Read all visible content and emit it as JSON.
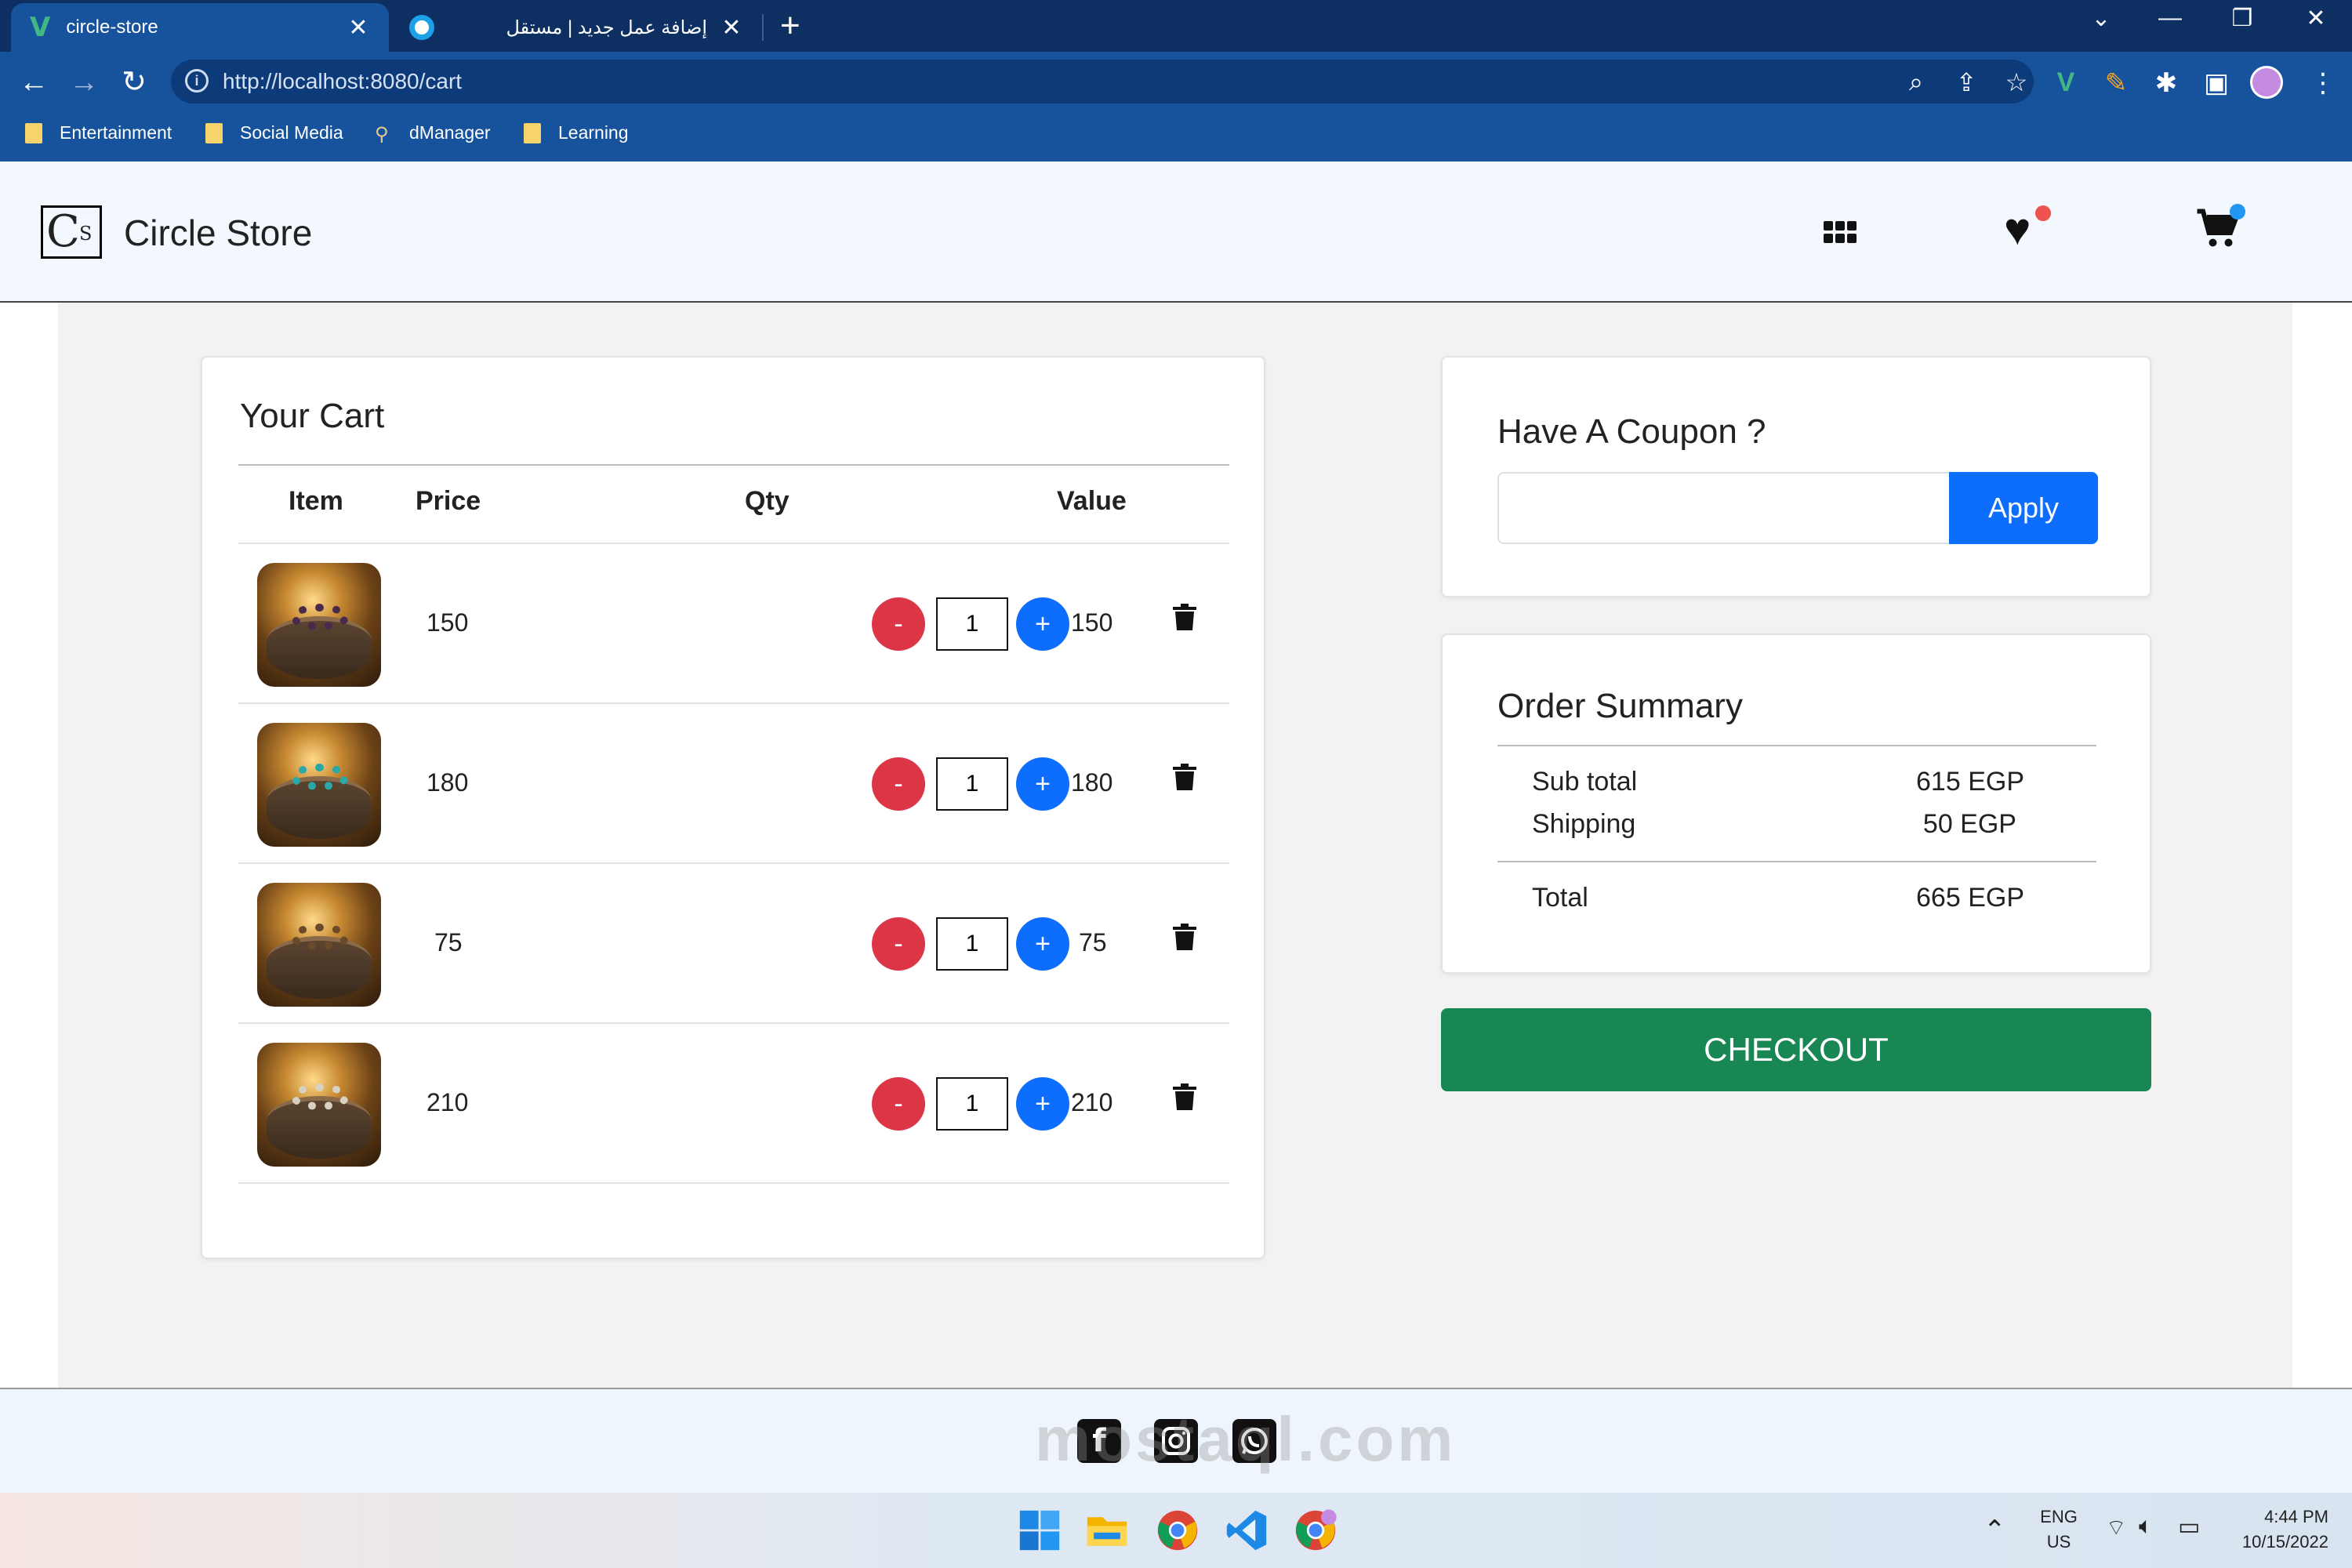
{
  "browser": {
    "tabs": [
      {
        "title": "circle-store",
        "active": true
      },
      {
        "title": "إضافة عمل جديد | مستقل",
        "active": false
      }
    ],
    "url": "http://localhost:8080/cart",
    "bookmarks": [
      "Entertainment",
      "Social Media",
      "dManager",
      "Learning"
    ]
  },
  "site": {
    "logo_letter": "C",
    "logo_sup": "S",
    "brand": "Circle Store"
  },
  "cart": {
    "title": "Your Cart",
    "headers": {
      "item": "Item",
      "price": "Price",
      "qty": "Qty",
      "value": "Value"
    },
    "items": [
      {
        "price": "150",
        "qty": "1",
        "value": "150"
      },
      {
        "price": "180",
        "qty": "1",
        "value": "180"
      },
      {
        "price": "75",
        "qty": "1",
        "value": "75"
      },
      {
        "price": "210",
        "qty": "1",
        "value": "210"
      }
    ],
    "minus_label": "-",
    "plus_label": "+"
  },
  "coupon": {
    "title": "Have A Coupon ?",
    "input_value": "",
    "apply_label": "Apply"
  },
  "summary": {
    "title": "Order Summary",
    "subtotal_label": "Sub total",
    "subtotal_value": "615 EGP",
    "shipping_label": "Shipping",
    "shipping_value": "50 EGP",
    "total_label": "Total",
    "total_value": "665 EGP"
  },
  "checkout_label": "CHECKOUT",
  "watermark": "mostaql.com",
  "taskbar": {
    "lang_top": "ENG",
    "lang_bottom": "US",
    "time": "4:44 PM",
    "date": "10/15/2022"
  },
  "colors": {
    "primary": "#0d6efd",
    "danger": "#dc3545",
    "success": "#198754",
    "chrome_dark": "#0d2f62",
    "chrome": "#17539d"
  }
}
